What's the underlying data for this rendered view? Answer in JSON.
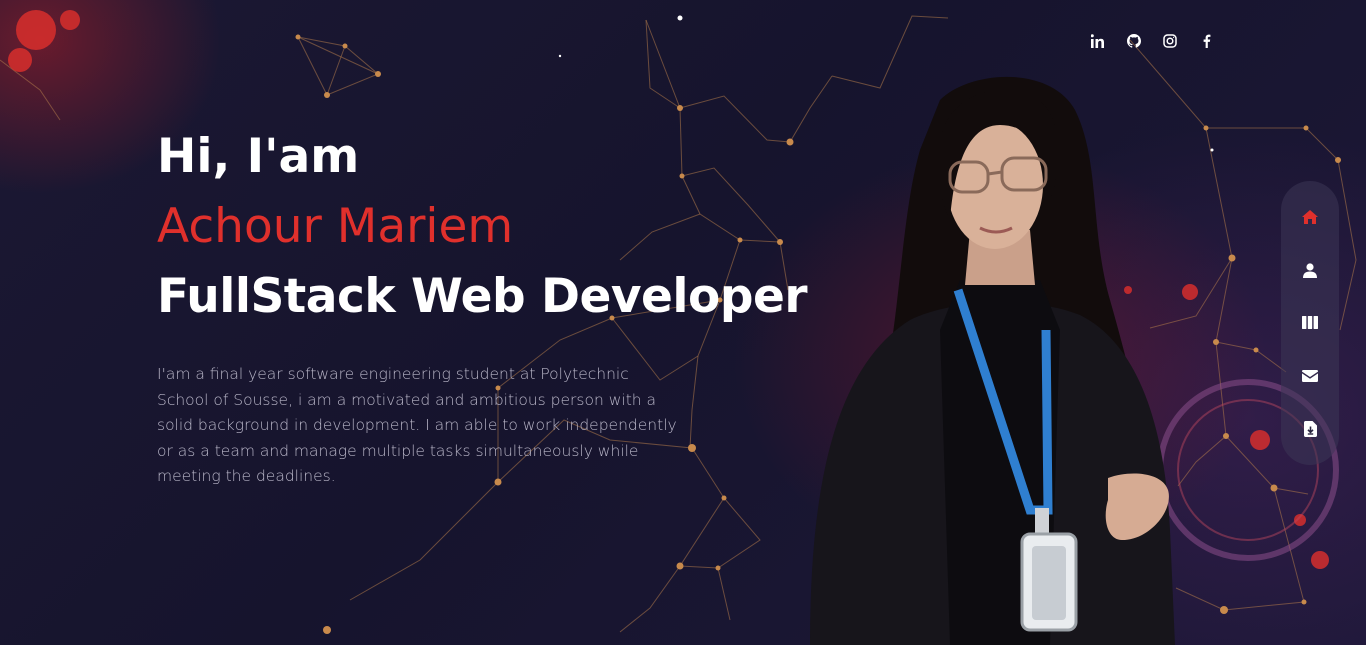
{
  "social": {
    "items": [
      {
        "name": "linkedin-icon",
        "label": "in"
      },
      {
        "name": "github-icon",
        "label": "github"
      },
      {
        "name": "instagram-icon",
        "label": "instagram"
      },
      {
        "name": "facebook-icon",
        "label": "f"
      }
    ]
  },
  "intro": {
    "greeting": "Hi, I'am",
    "name": "Achour Mariem",
    "role": "FullStack Web Developer",
    "bio": "I'am a final year software engineering student at Polytechnic School of Sousse, i am a motivated and ambitious person with a solid background in development. I am able to work independently or as a team and manage multiple tasks simultaneously while meeting the deadlines."
  },
  "sidenav": {
    "items": [
      {
        "name": "home-icon",
        "active": true
      },
      {
        "name": "user-icon",
        "active": false
      },
      {
        "name": "columns-icon",
        "active": false
      },
      {
        "name": "envelope-icon",
        "active": false
      },
      {
        "name": "download-icon",
        "active": false
      }
    ]
  },
  "colors": {
    "accent": "#e0302c",
    "background": "#171530",
    "text": "#ffffff",
    "muted_text": "#b9b6c8"
  }
}
